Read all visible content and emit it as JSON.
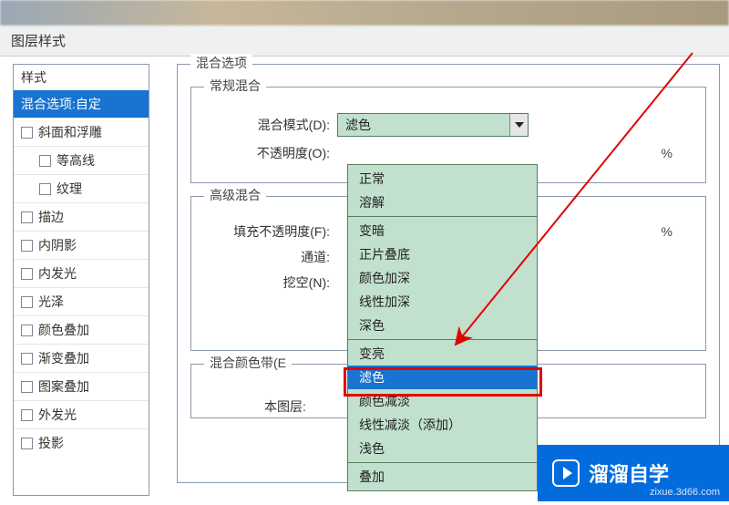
{
  "dialog": {
    "title": "图层样式"
  },
  "styles": {
    "header": "样式",
    "active": "混合选项:自定",
    "items": [
      {
        "label": "斜面和浮雕",
        "sub": false
      },
      {
        "label": "等高线",
        "sub": true
      },
      {
        "label": "纹理",
        "sub": true
      },
      {
        "label": "描边",
        "sub": false
      },
      {
        "label": "内阴影",
        "sub": false
      },
      {
        "label": "内发光",
        "sub": false
      },
      {
        "label": "光泽",
        "sub": false
      },
      {
        "label": "颜色叠加",
        "sub": false
      },
      {
        "label": "渐变叠加",
        "sub": false
      },
      {
        "label": "图案叠加",
        "sub": false
      },
      {
        "label": "外发光",
        "sub": false
      },
      {
        "label": "投影",
        "sub": false
      }
    ]
  },
  "blend": {
    "sectionTitle": "混合选项",
    "normal": {
      "title": "常规混合",
      "modeLabel": "混合模式(D):",
      "modeValue": "滤色",
      "opacityLabel": "不透明度(O):",
      "pct": "%"
    },
    "advanced": {
      "title": "高级混合",
      "fillLabel": "填充不透明度(F):",
      "channelLabel": "通道:",
      "knockoutLabel": "挖空(N):",
      "pct": "%"
    },
    "colorBand": {
      "title": "混合颜色带(E"
    },
    "thisLayer": "本图层: "
  },
  "dropdown": {
    "groups": [
      [
        "正常",
        "溶解"
      ],
      [
        "变暗",
        "正片叠底",
        "颜色加深",
        "线性加深",
        "深色"
      ],
      [
        "变亮",
        "滤色",
        "颜色减淡",
        "线性减淡（添加）",
        "浅色"
      ],
      [
        "叠加"
      ]
    ],
    "selected": "滤色"
  },
  "watermark": {
    "text": "溜溜自学",
    "sub": "zixue.3d66.com"
  }
}
